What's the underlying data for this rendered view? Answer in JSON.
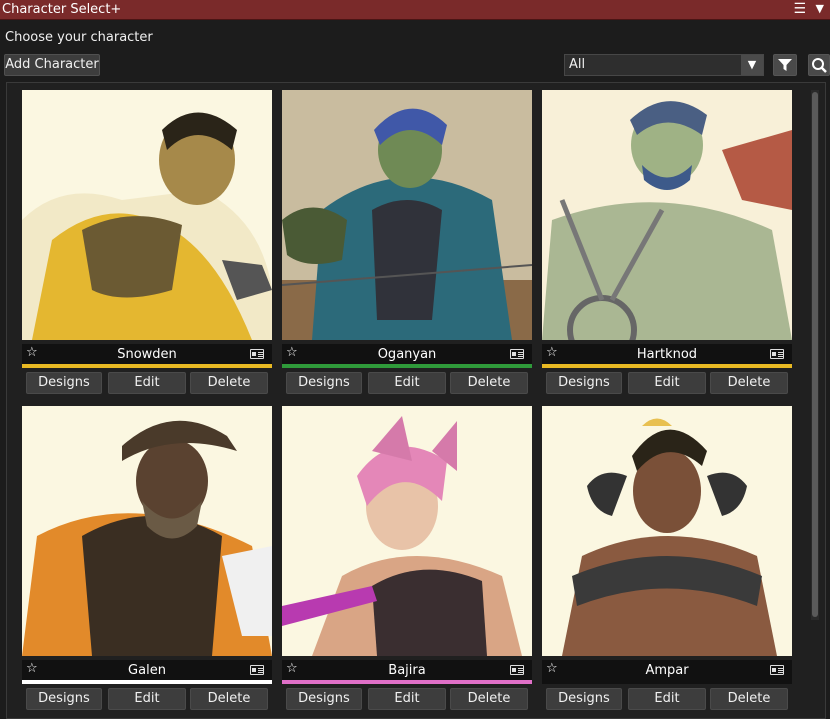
{
  "window": {
    "title": "Character Select+"
  },
  "subtitle": "Choose your character",
  "toolbar": {
    "add_label": "Add Character",
    "filter_value": "All"
  },
  "card_buttons": {
    "designs": "Designs",
    "edit": "Edit",
    "delete": "Delete"
  },
  "characters": [
    {
      "name": "Snowden",
      "color": "#e8b923"
    },
    {
      "name": "Oganyan",
      "color": "#2f9a3a"
    },
    {
      "name": "Hartknod",
      "color": "#e8b923"
    },
    {
      "name": "Galen",
      "color": "#ffffff"
    },
    {
      "name": "Bajira",
      "color": "#e070c8"
    },
    {
      "name": "Ampar",
      "color": "#111111"
    }
  ],
  "icons": [
    "menu-icon",
    "collapse-icon",
    "chevron-down-icon",
    "filter-icon",
    "search-icon",
    "star-icon",
    "id-card-icon"
  ]
}
